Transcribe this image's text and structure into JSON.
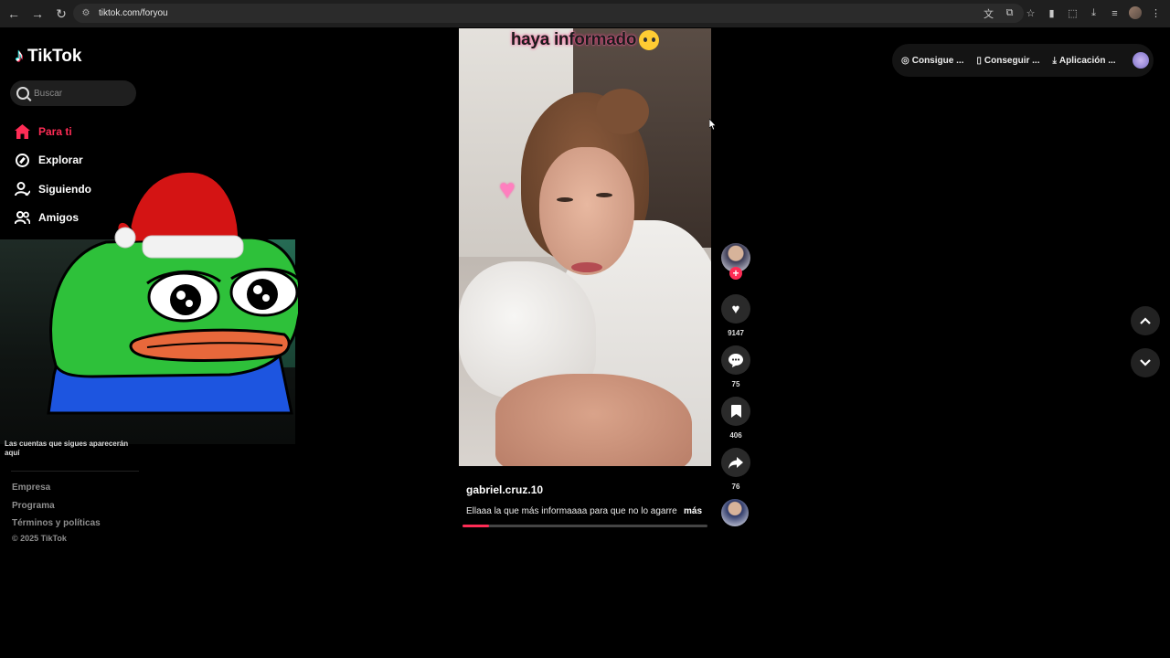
{
  "browser": {
    "url": "tiktok.com/foryou",
    "nav_back": "←",
    "nav_forward": "→",
    "nav_reload": "↻"
  },
  "sidebar": {
    "logo_text": "TikTok",
    "search_placeholder": "Buscar",
    "items": [
      {
        "label": "Para ti",
        "icon": "home-icon",
        "active": true
      },
      {
        "label": "Explorar",
        "icon": "compass-icon",
        "active": false
      },
      {
        "label": "Siguiendo",
        "icon": "following-icon",
        "active": false
      },
      {
        "label": "Amigos",
        "icon": "friends-icon",
        "active": false
      }
    ],
    "following_note": "Las cuentas que sigues aparecerán aquí",
    "footer_links": [
      "Empresa",
      "Programa",
      "Términos y políticas"
    ],
    "copyright": "© 2025 TikTok"
  },
  "video": {
    "caption_overlay": "haya informado",
    "author": "gabriel.cruz.10",
    "description": "Ellaaa la que más informaaaa para que no lo agarre",
    "more_label": "más",
    "progress": 0.11
  },
  "actions": {
    "likes": "9147",
    "comments": "75",
    "saves": "406",
    "shares": "76"
  },
  "top_right": {
    "coins": "Consigue ...",
    "get": "Conseguir ...",
    "app": "Aplicación ..."
  },
  "colors": {
    "accent": "#fe2c55",
    "background": "#000000",
    "surface": "#1f1f1f"
  }
}
